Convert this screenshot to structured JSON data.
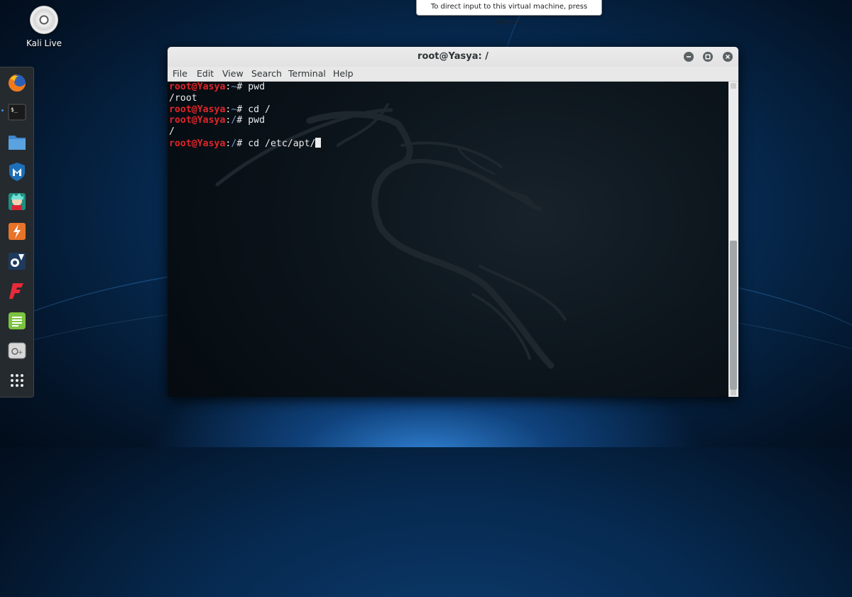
{
  "desktop": {
    "icon_label": "Kali Live"
  },
  "vm_tooltip": "To direct input to this virtual machine, press Ctrl+G.",
  "dock": {
    "items": [
      {
        "name": "firefox-icon"
      },
      {
        "name": "terminal-icon",
        "running": true
      },
      {
        "name": "files-icon"
      },
      {
        "name": "metasploit-icon"
      },
      {
        "name": "armitage-icon"
      },
      {
        "name": "burpsuite-icon"
      },
      {
        "name": "maltego-icon"
      },
      {
        "name": "faraday-icon"
      },
      {
        "name": "leafpad-icon"
      },
      {
        "name": "screenshot-icon"
      },
      {
        "name": "show-apps-icon"
      }
    ]
  },
  "window": {
    "title": "root@Yasya: /",
    "menu": [
      "File",
      "Edit",
      "View",
      "Search",
      "Terminal",
      "Help"
    ]
  },
  "terminal": {
    "user": "root@Yasya",
    "lines": [
      {
        "path": "~",
        "cmd": "pwd"
      },
      {
        "output": "/root"
      },
      {
        "path": "~",
        "cmd": "cd /"
      },
      {
        "path": "/",
        "cmd": "pwd"
      },
      {
        "output": "/"
      },
      {
        "path": "/",
        "cmd": "cd /etc/apt/",
        "cursor": true
      }
    ]
  },
  "colors": {
    "prompt_user": "#e0252a",
    "prompt_path": "#7a90c8",
    "dock_bg": "#252a2e",
    "active_indicator": "#3b8fe8"
  }
}
